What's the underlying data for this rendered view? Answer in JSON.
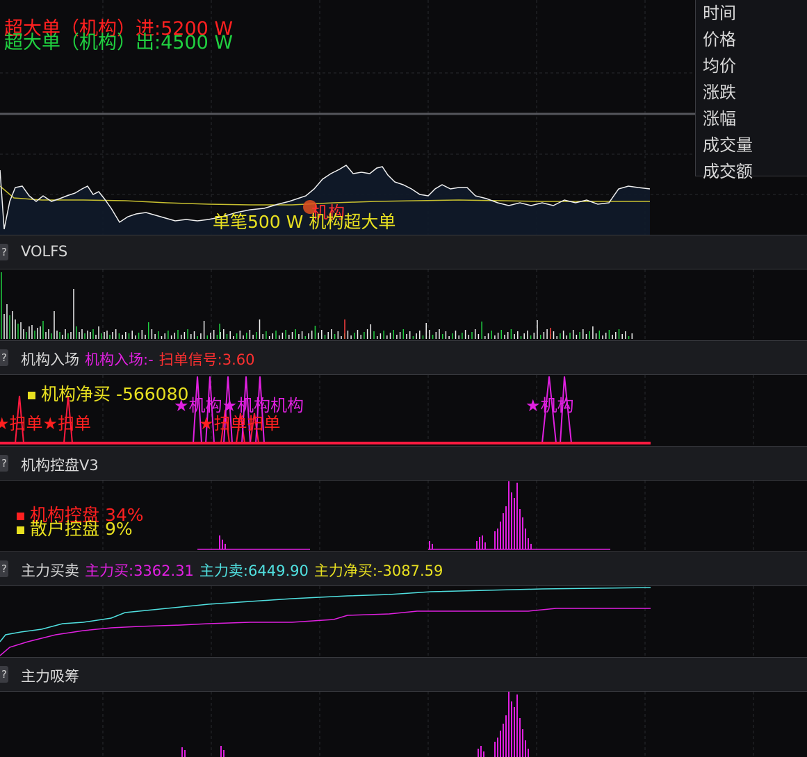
{
  "main": {
    "inflow_label": "超大单（机构）进:5200 W",
    "outflow_label": "超大单（机构）出:4500 W",
    "marker_label": "机构",
    "threshold_label": "单笔500 W 机构超大单"
  },
  "context_menu": {
    "items": [
      "时间",
      "价格",
      "均价",
      "涨跌",
      "涨幅",
      "成交量",
      "成交额"
    ]
  },
  "panels": {
    "volfs": {
      "help": "?",
      "title": "VOLFS"
    },
    "jigou_ruchang": {
      "help": "?",
      "title": "机构入场",
      "entry_label": "机构入场:-",
      "sweep_label": "扫单信号:3.60",
      "net_buy_label": "机构净买 -566080",
      "sweep_a": "★扫单★扫单",
      "jigou_a": "★机构★机构机构",
      "sweep_b": "★扫单扫单",
      "jigou_b": "★机构"
    },
    "jigou_kongpan": {
      "help": "?",
      "title": "机构控盘V3",
      "inst_label": "机构控盘 34%",
      "retail_label": "散户控盘 9%"
    },
    "zhuli_maimai": {
      "help": "?",
      "title": "主力买卖",
      "buy_label": "主力买:3362.31",
      "sell_label": "主力卖:6449.90",
      "net_label": "主力净买:-3087.59"
    },
    "zhuli_xichou": {
      "help": "?",
      "title": "主力吸筹"
    }
  },
  "colors": {
    "bg": "#0b0b0d",
    "grid": "#2a2b30",
    "red": "#ff2020",
    "green": "#20d040",
    "yellow": "#e8e020",
    "magenta": "#e020e0",
    "cyan": "#50e0e0",
    "white": "#f0f0f0"
  },
  "icons": {
    "help": "question-mark-icon"
  }
}
